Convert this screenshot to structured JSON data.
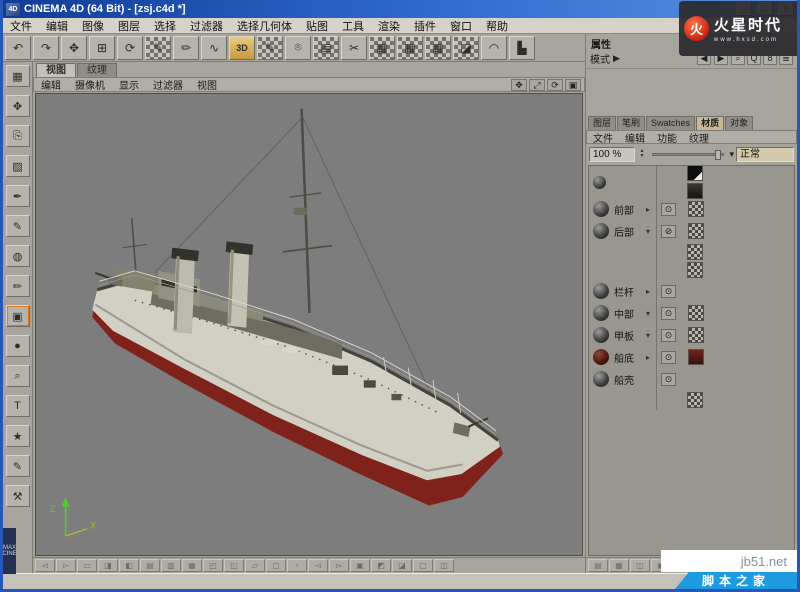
{
  "window": {
    "title": "CINEMA 4D (64 Bit) - [zsj.c4d *]",
    "icon_label": "4D",
    "min": "_",
    "max": "□",
    "close": "×"
  },
  "menu_bar": {
    "items": [
      "文件",
      "编辑",
      "图像",
      "图层",
      "选择",
      "过滤器",
      "选择几何体",
      "贴图",
      "工具",
      "渲染",
      "插件",
      "窗口",
      "帮助"
    ]
  },
  "top_toolbar": {
    "icons": [
      {
        "name": "undo-icon",
        "glyph": "↶"
      },
      {
        "name": "redo-icon",
        "glyph": "↷"
      },
      {
        "name": "move-icon",
        "glyph": "✥"
      },
      {
        "name": "scale-icon",
        "glyph": "⊞"
      },
      {
        "name": "rotate-icon",
        "glyph": "⟳"
      },
      {
        "name": "paint-brush-icon",
        "glyph": "✎",
        "cls": "chk"
      },
      {
        "name": "pencil-icon",
        "glyph": "✏"
      },
      {
        "name": "airbrush-icon",
        "glyph": "∿"
      },
      {
        "name": "3d-paint-icon",
        "glyph": "3D",
        "cls": "badge3d"
      },
      {
        "name": "smear-icon",
        "glyph": "✎",
        "cls": "chk"
      },
      {
        "name": "clone-stamp-icon",
        "glyph": "⌾"
      },
      {
        "name": "eraser-icon",
        "glyph": "▤",
        "cls": "chk"
      },
      {
        "name": "crop-icon",
        "glyph": "✂"
      },
      {
        "name": "texture-fill-icon",
        "glyph": "▦",
        "cls": "chk"
      },
      {
        "name": "texture-pattern-icon",
        "glyph": "▦",
        "cls": "chk"
      },
      {
        "name": "texture-tile-icon",
        "glyph": "▦",
        "cls": "chk"
      },
      {
        "name": "mask-icon",
        "glyph": "◪",
        "cls": "chk"
      },
      {
        "name": "curve-tool-icon",
        "glyph": "◠"
      },
      {
        "name": "histogram-icon",
        "glyph": "▙"
      }
    ]
  },
  "left_toolbar": {
    "icons": [
      {
        "name": "uv-grid-icon",
        "glyph": "▦",
        "cls": "red"
      },
      {
        "name": "move-tool-icon",
        "glyph": "✥"
      },
      {
        "name": "duplicate-icon",
        "glyph": "⎘"
      },
      {
        "name": "mask-select-icon",
        "glyph": "▨",
        "cls": "chk"
      },
      {
        "name": "pen-icon",
        "glyph": "✒"
      },
      {
        "name": "brush-icon",
        "glyph": "✎"
      },
      {
        "name": "fill-bucket-icon",
        "glyph": "◍",
        "cls": "orange"
      },
      {
        "name": "draw-pencil-icon",
        "glyph": "✏",
        "cls": "orange"
      },
      {
        "name": "frame-icon",
        "glyph": "▣",
        "cls": "orangeb"
      },
      {
        "name": "color-drop-icon",
        "glyph": "●",
        "cls": "orange"
      },
      {
        "name": "magnify-icon",
        "glyph": "⌕"
      },
      {
        "name": "text-tool-icon",
        "glyph": "T",
        "cls": "orange"
      },
      {
        "name": "shape-star-icon",
        "glyph": "★",
        "cls": "orange"
      },
      {
        "name": "edit-points-icon",
        "glyph": "✎"
      },
      {
        "name": "wrench-icon",
        "glyph": "⚒"
      }
    ],
    "brand_line1": "MAX",
    "brand_line2": "CINE"
  },
  "viewport": {
    "tabs": [
      {
        "label": "视图",
        "cls": "active"
      },
      {
        "label": "纹理",
        "cls": ""
      }
    ],
    "menus": [
      "编辑",
      "摄像机",
      "显示",
      "过滤器",
      "视图"
    ],
    "nav_icons": [
      {
        "name": "pan-view-icon",
        "glyph": "✥"
      },
      {
        "name": "zoom-view-icon",
        "glyph": "⤢"
      },
      {
        "name": "rotate-view-icon",
        "glyph": "⟳"
      },
      {
        "name": "maximize-view-icon",
        "glyph": "▣"
      }
    ],
    "axis_z": "Z",
    "axis_x": "X"
  },
  "attributes_panel": {
    "title": "属性",
    "mode_label": "模式",
    "mode_arrow": "▶",
    "nav": [
      "◀",
      "▶"
    ],
    "icons": [
      {
        "name": "magnify-icon",
        "glyph": "⌕"
      },
      {
        "name": "quick-icon",
        "glyph": "Q"
      },
      {
        "name": "filter-icon",
        "glyph": "8"
      },
      {
        "name": "panel-menu-icon",
        "glyph": "≣"
      }
    ]
  },
  "materials_panel": {
    "tabs": [
      {
        "label": "图层",
        "cls": ""
      },
      {
        "label": "笔刷",
        "cls": ""
      },
      {
        "label": "Swatches",
        "cls": ""
      },
      {
        "label": "材质",
        "cls": "active"
      },
      {
        "label": "对象",
        "cls": ""
      }
    ],
    "menus": [
      "文件",
      "编辑",
      "功能",
      "纹理"
    ],
    "zoom": "100 %",
    "blend_mode": "正常",
    "materials": [
      {
        "name": "前部",
        "arrow": "▸",
        "eye": "⊙"
      },
      {
        "name": "后部",
        "arrow": "▾",
        "eye": "⊘"
      },
      {
        "name": "栏杆",
        "arrow": "▸",
        "eye": "⊙"
      },
      {
        "name": "中部",
        "arrow": "▾",
        "eye": "⊙"
      },
      {
        "name": "甲板",
        "arrow": "▾",
        "eye": "⊙"
      },
      {
        "name": "船底",
        "arrow": "▸",
        "eye": "⊙"
      },
      {
        "name": "船壳",
        "arrow": "",
        "eye": "⊙"
      }
    ]
  },
  "bottom_toolbar": {
    "icons": [
      {
        "glyph": "◅"
      },
      {
        "glyph": "▻"
      },
      {
        "glyph": "▭"
      },
      {
        "glyph": "◨"
      },
      {
        "glyph": "◧"
      },
      {
        "glyph": "▤"
      },
      {
        "glyph": "▥"
      },
      {
        "glyph": "▦"
      },
      {
        "glyph": "◰"
      },
      {
        "glyph": "◱"
      },
      {
        "glyph": "▱"
      },
      {
        "glyph": "◻"
      },
      {
        "glyph": "▫"
      },
      {
        "glyph": "◅"
      },
      {
        "glyph": "▻"
      },
      {
        "glyph": "▣"
      },
      {
        "glyph": "◩"
      },
      {
        "glyph": "◪"
      },
      {
        "glyph": "▢"
      },
      {
        "glyph": "◫"
      }
    ]
  },
  "rp_bottom": {
    "left_icons": [
      {
        "glyph": "▤"
      },
      {
        "glyph": "▦"
      },
      {
        "glyph": "◫"
      },
      {
        "glyph": "▣"
      },
      {
        "glyph": "≣"
      }
    ],
    "right_icons": [
      {
        "glyph": "⌸"
      },
      {
        "glyph": "▥"
      },
      {
        "glyph": "◨"
      }
    ]
  },
  "ui": {
    "up": "▴",
    "down": "▾",
    "dropdown": "▾"
  },
  "watermarks": {
    "hxsd": {
      "logo_glyph": "火",
      "brand": "火星时代",
      "url": "www.hxsd.com"
    },
    "jb51": {
      "site": "jb51.net",
      "badge": "脚本之家"
    }
  }
}
